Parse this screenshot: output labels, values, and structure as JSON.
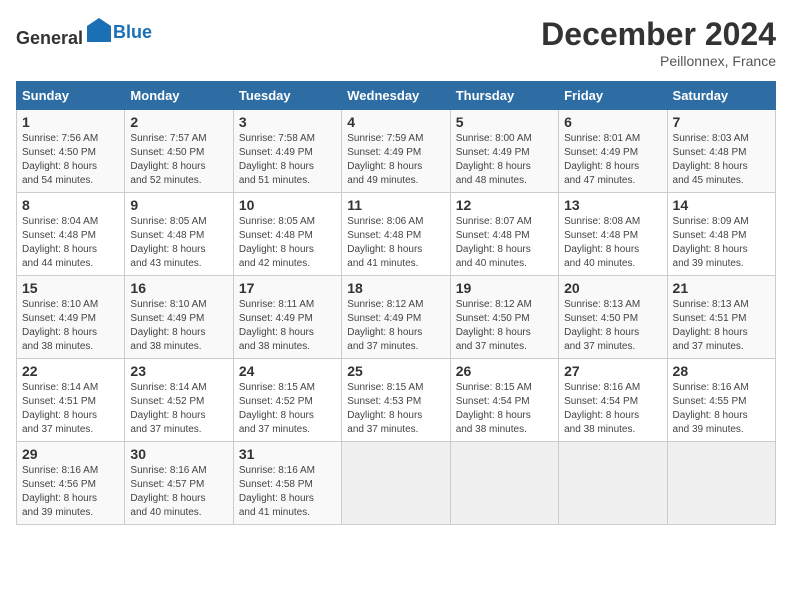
{
  "header": {
    "logo_general": "General",
    "logo_blue": "Blue",
    "title": "December 2024",
    "subtitle": "Peillonnex, France"
  },
  "days_of_week": [
    "Sunday",
    "Monday",
    "Tuesday",
    "Wednesday",
    "Thursday",
    "Friday",
    "Saturday"
  ],
  "weeks": [
    [
      {
        "day": "1",
        "info": "Sunrise: 7:56 AM\nSunset: 4:50 PM\nDaylight: 8 hours\nand 54 minutes."
      },
      {
        "day": "2",
        "info": "Sunrise: 7:57 AM\nSunset: 4:50 PM\nDaylight: 8 hours\nand 52 minutes."
      },
      {
        "day": "3",
        "info": "Sunrise: 7:58 AM\nSunset: 4:49 PM\nDaylight: 8 hours\nand 51 minutes."
      },
      {
        "day": "4",
        "info": "Sunrise: 7:59 AM\nSunset: 4:49 PM\nDaylight: 8 hours\nand 49 minutes."
      },
      {
        "day": "5",
        "info": "Sunrise: 8:00 AM\nSunset: 4:49 PM\nDaylight: 8 hours\nand 48 minutes."
      },
      {
        "day": "6",
        "info": "Sunrise: 8:01 AM\nSunset: 4:49 PM\nDaylight: 8 hours\nand 47 minutes."
      },
      {
        "day": "7",
        "info": "Sunrise: 8:03 AM\nSunset: 4:48 PM\nDaylight: 8 hours\nand 45 minutes."
      }
    ],
    [
      {
        "day": "8",
        "info": "Sunrise: 8:04 AM\nSunset: 4:48 PM\nDaylight: 8 hours\nand 44 minutes."
      },
      {
        "day": "9",
        "info": "Sunrise: 8:05 AM\nSunset: 4:48 PM\nDaylight: 8 hours\nand 43 minutes."
      },
      {
        "day": "10",
        "info": "Sunrise: 8:05 AM\nSunset: 4:48 PM\nDaylight: 8 hours\nand 42 minutes."
      },
      {
        "day": "11",
        "info": "Sunrise: 8:06 AM\nSunset: 4:48 PM\nDaylight: 8 hours\nand 41 minutes."
      },
      {
        "day": "12",
        "info": "Sunrise: 8:07 AM\nSunset: 4:48 PM\nDaylight: 8 hours\nand 40 minutes."
      },
      {
        "day": "13",
        "info": "Sunrise: 8:08 AM\nSunset: 4:48 PM\nDaylight: 8 hours\nand 40 minutes."
      },
      {
        "day": "14",
        "info": "Sunrise: 8:09 AM\nSunset: 4:48 PM\nDaylight: 8 hours\nand 39 minutes."
      }
    ],
    [
      {
        "day": "15",
        "info": "Sunrise: 8:10 AM\nSunset: 4:49 PM\nDaylight: 8 hours\nand 38 minutes."
      },
      {
        "day": "16",
        "info": "Sunrise: 8:10 AM\nSunset: 4:49 PM\nDaylight: 8 hours\nand 38 minutes."
      },
      {
        "day": "17",
        "info": "Sunrise: 8:11 AM\nSunset: 4:49 PM\nDaylight: 8 hours\nand 38 minutes."
      },
      {
        "day": "18",
        "info": "Sunrise: 8:12 AM\nSunset: 4:49 PM\nDaylight: 8 hours\nand 37 minutes."
      },
      {
        "day": "19",
        "info": "Sunrise: 8:12 AM\nSunset: 4:50 PM\nDaylight: 8 hours\nand 37 minutes."
      },
      {
        "day": "20",
        "info": "Sunrise: 8:13 AM\nSunset: 4:50 PM\nDaylight: 8 hours\nand 37 minutes."
      },
      {
        "day": "21",
        "info": "Sunrise: 8:13 AM\nSunset: 4:51 PM\nDaylight: 8 hours\nand 37 minutes."
      }
    ],
    [
      {
        "day": "22",
        "info": "Sunrise: 8:14 AM\nSunset: 4:51 PM\nDaylight: 8 hours\nand 37 minutes."
      },
      {
        "day": "23",
        "info": "Sunrise: 8:14 AM\nSunset: 4:52 PM\nDaylight: 8 hours\nand 37 minutes."
      },
      {
        "day": "24",
        "info": "Sunrise: 8:15 AM\nSunset: 4:52 PM\nDaylight: 8 hours\nand 37 minutes."
      },
      {
        "day": "25",
        "info": "Sunrise: 8:15 AM\nSunset: 4:53 PM\nDaylight: 8 hours\nand 37 minutes."
      },
      {
        "day": "26",
        "info": "Sunrise: 8:15 AM\nSunset: 4:54 PM\nDaylight: 8 hours\nand 38 minutes."
      },
      {
        "day": "27",
        "info": "Sunrise: 8:16 AM\nSunset: 4:54 PM\nDaylight: 8 hours\nand 38 minutes."
      },
      {
        "day": "28",
        "info": "Sunrise: 8:16 AM\nSunset: 4:55 PM\nDaylight: 8 hours\nand 39 minutes."
      }
    ],
    [
      {
        "day": "29",
        "info": "Sunrise: 8:16 AM\nSunset: 4:56 PM\nDaylight: 8 hours\nand 39 minutes."
      },
      {
        "day": "30",
        "info": "Sunrise: 8:16 AM\nSunset: 4:57 PM\nDaylight: 8 hours\nand 40 minutes."
      },
      {
        "day": "31",
        "info": "Sunrise: 8:16 AM\nSunset: 4:58 PM\nDaylight: 8 hours\nand 41 minutes."
      },
      null,
      null,
      null,
      null
    ]
  ]
}
